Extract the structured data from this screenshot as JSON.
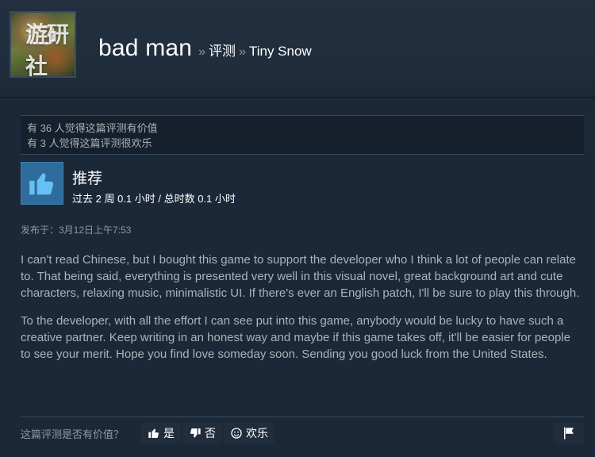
{
  "header": {
    "watermark": "游研社",
    "profile_name": "bad man",
    "breadcrumb_separator": "»",
    "breadcrumb_reviews": "评测",
    "breadcrumb_game": "Tiny Snow"
  },
  "votes": {
    "helpful_line": "有 36 人觉得这篇评测有价值",
    "funny_line": "有 3 人觉得这篇评测很欢乐"
  },
  "recommendation": {
    "label": "推荐",
    "hours": "过去 2 周 0.1 小时 / 总时数 0.1 小时",
    "icon": "thumbs-up-icon"
  },
  "posted": "发布于：3月12日上午7:53",
  "review": {
    "paragraphs": [
      "I can't read Chinese, but I bought this game to support the developer who I think a lot of people can relate to. That being said, everything is presented very well in this visual novel, great background art and cute characters, relaxing music, minimalistic UI. If there's ever an English patch, I'll be sure to play this through.",
      "To the developer, with all the effort I can see put into this game, anybody would be lucky to have such a creative partner. Keep writing in an honest way and maybe if this game takes off, it'll be easier for people to see your merit. Hope you find love someday soon. Sending you good luck from the United States."
    ]
  },
  "footer": {
    "question": "这篇评测是否有价值？",
    "yes_label": "是",
    "no_label": "否",
    "funny_label": "欢乐"
  },
  "colors": {
    "background": "#1b2838",
    "accent_blue": "#2f6b9c",
    "text_muted": "#8f98a0",
    "text_body": "#acb2b8"
  }
}
